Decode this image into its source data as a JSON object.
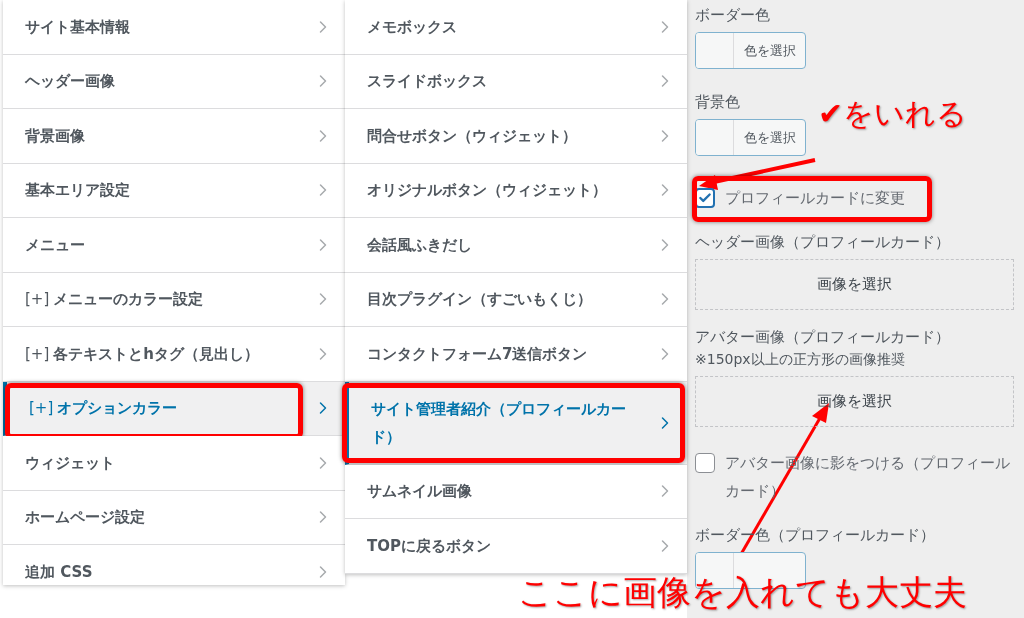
{
  "menu": {
    "items": [
      {
        "label": "サイト基本情報",
        "selected": false,
        "highlighted": false
      },
      {
        "label": "ヘッダー画像",
        "selected": false,
        "highlighted": false
      },
      {
        "label": "背景画像",
        "selected": false,
        "highlighted": false
      },
      {
        "label": "基本エリア設定",
        "selected": false,
        "highlighted": false
      },
      {
        "label": "メニュー",
        "selected": false,
        "highlighted": false
      },
      {
        "prefix": "[+]",
        "label": "メニューのカラー設定",
        "selected": false,
        "highlighted": false
      },
      {
        "prefix": "[+]",
        "label": "各テキストとhタグ（見出し）",
        "selected": false,
        "highlighted": false
      },
      {
        "prefix": "[+]",
        "label": "オプションカラー",
        "selected": true,
        "highlighted": true
      },
      {
        "label": "ウィジェット",
        "selected": false,
        "highlighted": false
      },
      {
        "label": "ホームページ設定",
        "selected": false,
        "highlighted": false
      },
      {
        "label": "追加 CSS",
        "selected": false,
        "highlighted": false
      }
    ]
  },
  "submenu": {
    "items": [
      {
        "label": "メモボックス",
        "selected": false,
        "highlighted": false
      },
      {
        "label": "スライドボックス",
        "selected": false,
        "highlighted": false
      },
      {
        "label": "問合せボタン（ウィジェット）",
        "selected": false,
        "highlighted": false
      },
      {
        "label": "オリジナルボタン（ウィジェット）",
        "selected": false,
        "highlighted": false
      },
      {
        "label": "会話風ふきだし",
        "selected": false,
        "highlighted": false
      },
      {
        "label": "目次プラグイン（すごいもくじ）",
        "selected": false,
        "highlighted": false
      },
      {
        "label": "コンタクトフォーム7送信ボタン",
        "selected": false,
        "highlighted": false
      },
      {
        "label": "サイト管理者紹介（プロフィールカード）",
        "selected": true,
        "highlighted": true
      },
      {
        "label": "サムネイル画像",
        "selected": false,
        "highlighted": false
      },
      {
        "label": "TOPに戻るボタン",
        "selected": false,
        "highlighted": false
      }
    ]
  },
  "panel": {
    "fields": [
      {
        "kind": "color",
        "label": "ボーダー色",
        "button": "色を選択"
      },
      {
        "kind": "color",
        "label": "背景色",
        "button": "色を選択"
      },
      {
        "kind": "checkbox",
        "label": "プロフィールカードに変更",
        "checked": true,
        "highlighted": true
      },
      {
        "kind": "image",
        "label": "ヘッダー画像（プロフィールカード）",
        "button": "画像を選択"
      },
      {
        "kind": "image",
        "label": "アバター画像（プロフィールカード）",
        "note": "※150px以上の正方形の画像推奨",
        "button": "画像を選択"
      },
      {
        "kind": "checkbox",
        "label": "アバター画像に影をつける（プロフィールカード）",
        "checked": false,
        "highlighted": false
      },
      {
        "kind": "color",
        "label": "ボーダー色（プロフィールカード）"
      }
    ]
  },
  "annotations": [
    {
      "text": "✔をいれる"
    },
    {
      "text": "ここに画像を入れても大丈夫"
    }
  ]
}
